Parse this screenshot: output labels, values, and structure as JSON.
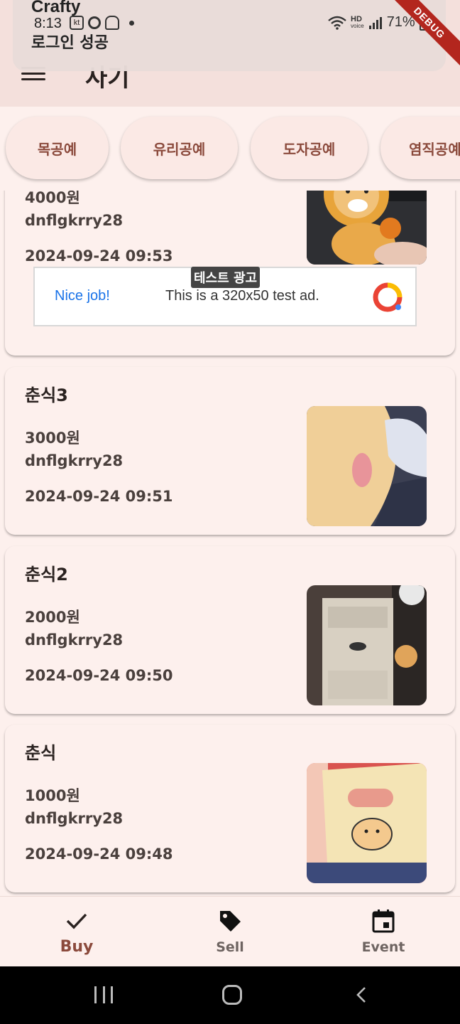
{
  "status_bar": {
    "app_name": "Crafty",
    "time": "8:13",
    "kt_label": "kt",
    "toast_message": "로그인 성공",
    "hd_label": "HD",
    "voice_label": "voice",
    "battery": "71%"
  },
  "debug_banner": "DEBUG",
  "app_bar": {
    "title": "사기",
    "menu_icon": "hamburger-menu-icon"
  },
  "categories": [
    "목공예",
    "유리공예",
    "도자공예",
    "염직공예"
  ],
  "ad": {
    "label": "테스트 광고",
    "nice": "Nice job!",
    "text": "This is a 320x50 test ad."
  },
  "items": [
    {
      "title": "",
      "price": "4000원",
      "seller": "dnflgkrry28",
      "date": "2024-09-24 09:53",
      "image": "plush-lion-toy"
    },
    {
      "title": "춘식3",
      "price": "3000원",
      "seller": "dnflgkrry28",
      "date": "2024-09-24 09:51",
      "image": "plush-closeup-bed"
    },
    {
      "title": "춘식2",
      "price": "2000원",
      "seller": "dnflgkrry28",
      "date": "2024-09-24 09:50",
      "image": "plush-by-air-conditioner"
    },
    {
      "title": "춘식",
      "price": "1000원",
      "seller": "dnflgkrry28",
      "date": "2024-09-24 09:48",
      "image": "choonsik-pouch"
    }
  ],
  "bottom_nav": [
    {
      "label": "Buy",
      "icon": "check-icon",
      "active": true
    },
    {
      "label": "Sell",
      "icon": "tag-icon",
      "active": false
    },
    {
      "label": "Event",
      "icon": "calendar-icon",
      "active": false
    }
  ],
  "colors": {
    "accent": "#8b4a3c",
    "background": "#fdf0ed",
    "appbar": "#f4e0dc"
  }
}
